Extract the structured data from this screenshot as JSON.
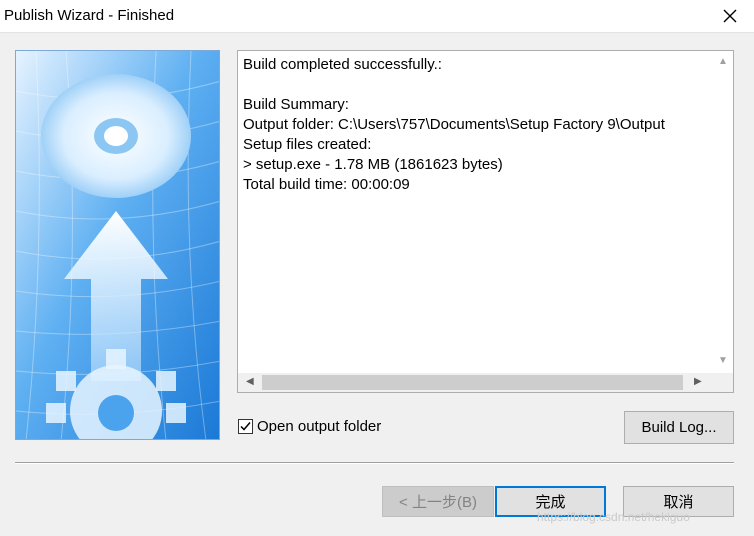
{
  "window": {
    "title": "Publish Wizard - Finished"
  },
  "log": {
    "text": "Build completed successfully.:\n\nBuild Summary:\nOutput folder: C:\\Users\\757\\Documents\\Setup Factory 9\\Output\nSetup files created:\n> setup.exe - 1.78 MB (1861623 bytes)\nTotal build time: 00:00:09"
  },
  "options": {
    "open_output_folder_label": "Open output folder",
    "open_output_folder_checked": true
  },
  "buttons": {
    "build_log": "Build Log...",
    "back": "< 上一步(B)",
    "finish": "完成",
    "cancel": "取消"
  },
  "watermark": "https://blog.csdn.net/hekiguo",
  "colors": {
    "accent": "#0078d7",
    "image_blue": "#2b8be0"
  },
  "icons": {
    "close": "close-icon",
    "checkmark": "checkmark-icon",
    "scroll_up": "scroll-up-icon",
    "scroll_down": "scroll-down-icon",
    "scroll_left": "scroll-left-icon",
    "scroll_right": "scroll-right-icon"
  }
}
